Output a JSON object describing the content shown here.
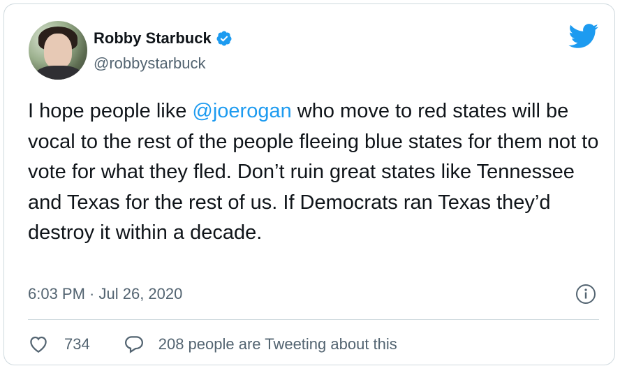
{
  "author": {
    "display_name": "Robby Starbuck",
    "handle": "@robbystarbuck",
    "verified": true,
    "avatar_icon": "profile-photo"
  },
  "tweet": {
    "text_before": "I hope people like ",
    "mention": "@joerogan",
    "text_after": " who move to red states will be vocal to the rest of the people fleeing blue states for them not to vote for what they fled. Don’t ruin great states like Tennessee and Texas for the rest of us. If Democrats ran Texas they’d destroy it within a decade.",
    "timestamp": "6:03 PM · Jul 26, 2020"
  },
  "actions": {
    "like_count": "734",
    "reply_label": "208 people are Tweeting about this"
  },
  "icons": {
    "brand": "twitter-bird-icon",
    "verified": "verified-badge-icon",
    "info": "info-icon",
    "like": "heart-icon",
    "reply": "speech-bubble-icon"
  },
  "colors": {
    "brand": "#1d9bf0",
    "text": "#0f1419",
    "secondary": "#536471",
    "border": "#cfd9de"
  }
}
